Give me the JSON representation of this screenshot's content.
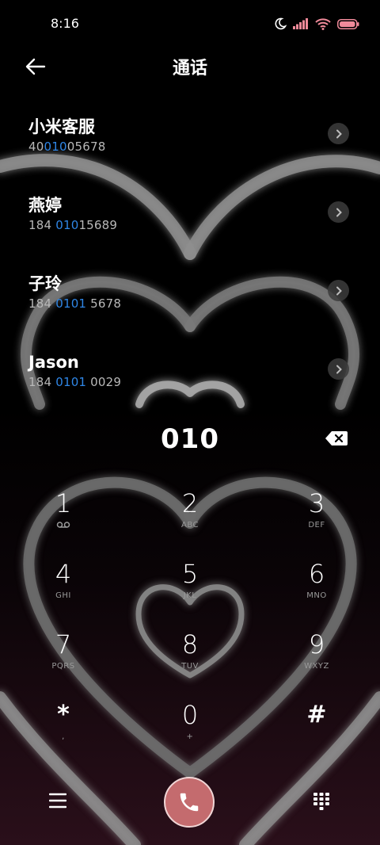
{
  "status_bar": {
    "time": "8:16",
    "icons": [
      "moon-icon",
      "signal-icon",
      "wifi-icon",
      "battery-icon"
    ],
    "battery_color": "#f08a9a"
  },
  "header": {
    "title": "通话",
    "back_icon": "back-arrow-icon"
  },
  "contacts": [
    {
      "name": "小米客服",
      "number_pre": "40",
      "number_hl": "010",
      "number_post": "05678"
    },
    {
      "name": "燕婷",
      "number_pre": "184 ",
      "number_hl": "010",
      "number_post": "15689"
    },
    {
      "name": "子玲",
      "number_pre": "184 ",
      "number_hl": "0101",
      "number_post": " 5678"
    },
    {
      "name": "Jason",
      "number_pre": "184 ",
      "number_hl": "0101",
      "number_post": " 0029"
    }
  ],
  "highlight_color": "#2f86e6",
  "dial": {
    "input_value": "010",
    "backspace_icon": "backspace-icon"
  },
  "keypad": {
    "k1": {
      "digit": "1",
      "sub": "voicemail-icon"
    },
    "k2": {
      "digit": "2",
      "sub": "ABC"
    },
    "k3": {
      "digit": "3",
      "sub": "DEF"
    },
    "k4": {
      "digit": "4",
      "sub": "GHI"
    },
    "k5": {
      "digit": "5",
      "sub": "JKL"
    },
    "k6": {
      "digit": "6",
      "sub": "MNO"
    },
    "k7": {
      "digit": "7",
      "sub": "PQRS"
    },
    "k8": {
      "digit": "8",
      "sub": "TUV"
    },
    "k9": {
      "digit": "9",
      "sub": "WXYZ"
    },
    "kstar": {
      "digit": "*",
      "sub": ","
    },
    "k0": {
      "digit": "0",
      "sub": "+"
    },
    "khash": {
      "digit": "#",
      "sub": ""
    }
  },
  "bottom_bar": {
    "menu_icon": "menu-icon",
    "call_icon": "phone-icon",
    "call_color": "#c46b6e",
    "keypad_icon": "dialpad-grid-icon"
  }
}
